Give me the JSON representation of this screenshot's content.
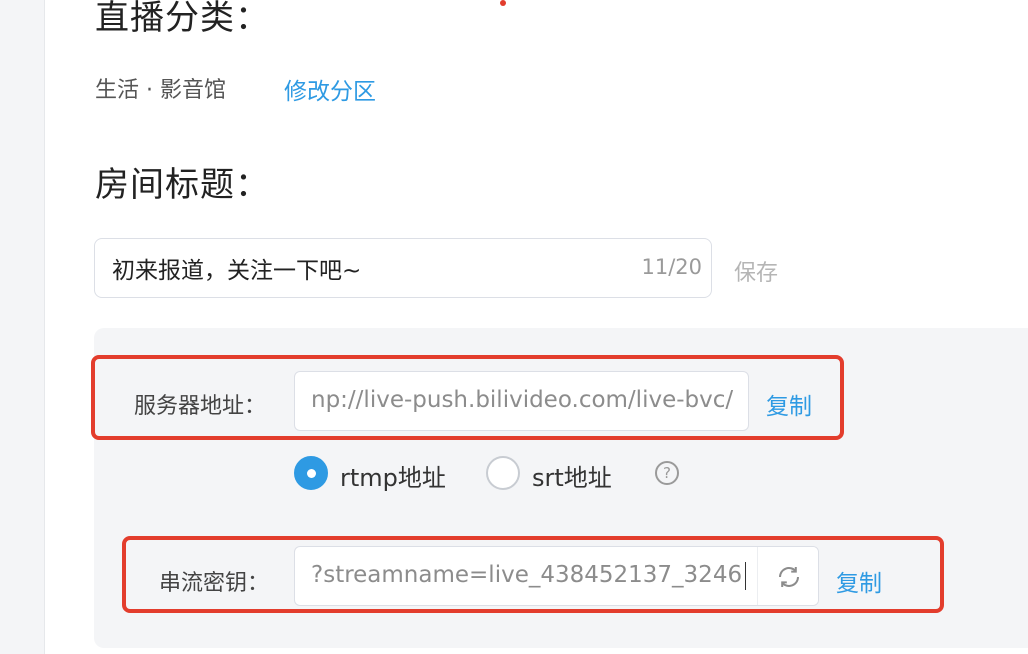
{
  "category": {
    "heading": "直播分类：",
    "value": "生活 · 影音馆",
    "change_link": "修改分区"
  },
  "room_title": {
    "heading": "房间标题：",
    "input_value": "初来报道，关注一下吧~",
    "counter": "11/20",
    "save_label": "保存"
  },
  "stream": {
    "server_label": "服务器地址：",
    "server_value": "np://live-push.bilivideo.com/live-bvc/",
    "server_copy": "复制",
    "protocol_options": [
      {
        "label": "rtmp地址",
        "selected": true
      },
      {
        "label": "srt地址",
        "selected": false
      }
    ],
    "help_icon": "?",
    "key_label": "串流密钥：",
    "key_value": "?streamname=live_438452137_3246",
    "key_copy": "复制"
  },
  "colors": {
    "accent": "#2e9ae3",
    "highlight_red": "#e33d2d",
    "panel_bg": "#f4f5f7"
  },
  "icons": {
    "refresh": "refresh-icon",
    "help": "question-circle-icon"
  }
}
